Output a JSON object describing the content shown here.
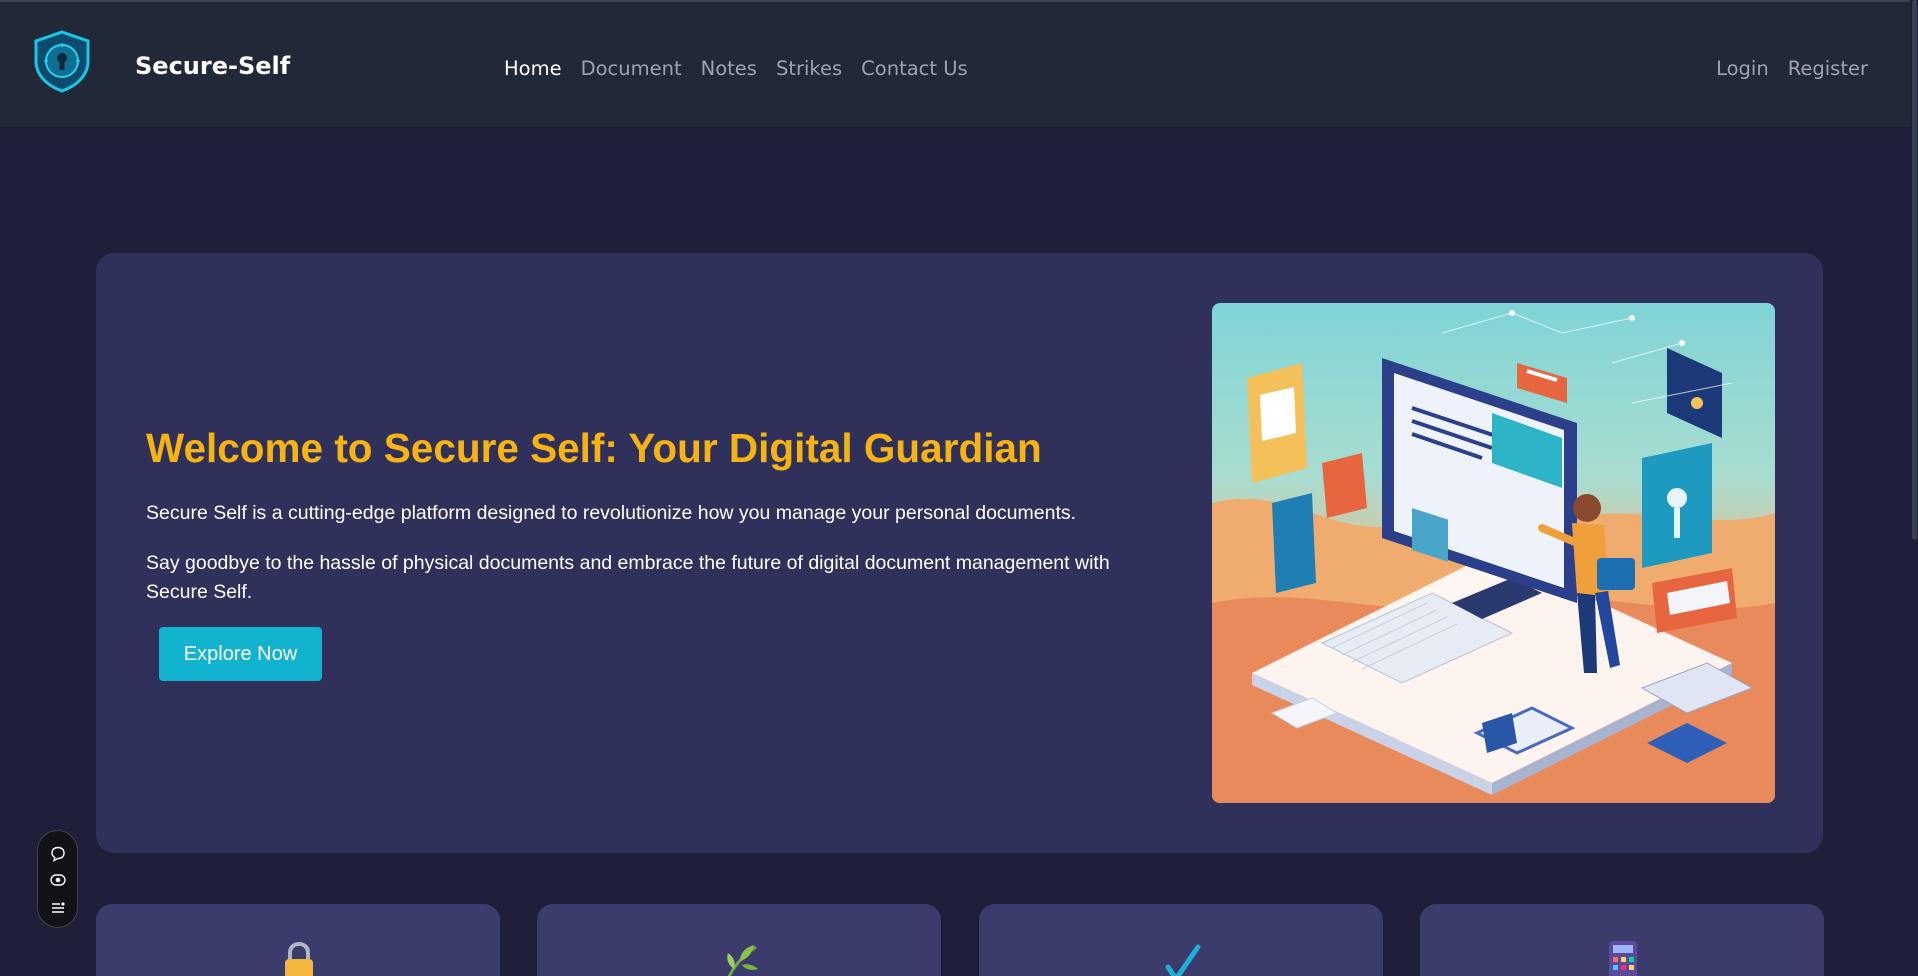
{
  "app": {
    "brand": "Secure-Self"
  },
  "nav": {
    "items": [
      {
        "label": "Home",
        "active": true
      },
      {
        "label": "Document",
        "active": false
      },
      {
        "label": "Notes",
        "active": false
      },
      {
        "label": "Strikes",
        "active": false
      },
      {
        "label": "Contact Us",
        "active": false
      }
    ],
    "auth": [
      {
        "label": "Login"
      },
      {
        "label": "Register"
      }
    ]
  },
  "hero": {
    "title": "Welcome to Secure Self: Your Digital Guardian",
    "paragraph1": "Secure Self is a cutting-edge platform designed to revolutionize how you manage your personal documents.",
    "paragraph2": "Say goodbye to the hassle of physical documents and embrace the future of digital document management with Secure Self.",
    "cta_label": "Explore Now",
    "image": "isometric-digital-document-illustration"
  },
  "widget": {
    "icons": [
      "chat-icon",
      "visibility-icon",
      "menu-icon"
    ]
  },
  "cards": [
    {
      "icon": "lock-icon"
    },
    {
      "icon": "leaf-icon"
    },
    {
      "icon": "checkmark-icon"
    },
    {
      "icon": "calculator-icon"
    }
  ],
  "colors": {
    "background": "#1f1f3a",
    "navbar": "#212838",
    "hero_panel": "#30315a",
    "title_accent": "#f7b312",
    "cta": "#11b3cf",
    "card": "#3b3c6b"
  }
}
